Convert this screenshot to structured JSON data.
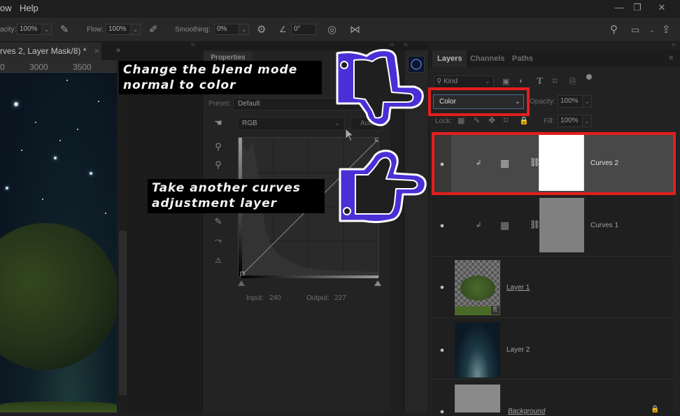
{
  "menu": {
    "items": [
      "ow",
      "Help"
    ],
    "window_controls": {
      "minimize": "—",
      "restore": "❐",
      "close": "✕"
    }
  },
  "options_bar": {
    "opacity_label": "acity:",
    "opacity_value": "100%",
    "flow_label": "Flow:",
    "flow_value": "100%",
    "smoothing_label": "Smoothing:",
    "smoothing_value": "0%",
    "angle_value": "0°",
    "icons": [
      "airbrush-icon",
      "pressure-opacity-icon",
      "settings-gear-icon",
      "angle-icon",
      "pressure-size-icon",
      "symmetry-butterfly-icon",
      "search-icon",
      "workspace-icon",
      "share-icon"
    ]
  },
  "document": {
    "tab_title": "rves 2, Layer Mask/8) *",
    "tab_close": "×",
    "ruler_ticks": [
      "0",
      "3000",
      "3500"
    ]
  },
  "properties": {
    "tab_label": "Properties",
    "preset_label": "Preset:",
    "preset_value": "Default",
    "channel_value": "RGB",
    "auto_label": "Auto",
    "input_label": "Input:",
    "input_value": "240",
    "output_label": "Output:",
    "output_value": "227",
    "tools": [
      "on-image-adjust-icon",
      "black-point-eyedropper-icon",
      "gray-point-eyedropper-icon",
      "white-point-eyedropper-icon",
      "pencil-icon",
      "smooth-curve-icon",
      "clipping-warning-icon"
    ]
  },
  "layers_panel": {
    "tabs": [
      {
        "label": "Layers",
        "active": true
      },
      {
        "label": "Channels",
        "active": false
      },
      {
        "label": "Paths",
        "active": false
      }
    ],
    "filter_label": "Kind",
    "blend_mode": "Color",
    "opacity_label": "Opacity:",
    "opacity_value": "100%",
    "lock_label": "Lock:",
    "fill_label": "Fill:",
    "fill_value": "100%",
    "layers": [
      {
        "name": "Curves 2",
        "type": "adjustment",
        "selected": true,
        "visible": true,
        "mask": "white"
      },
      {
        "name": "Curves 1",
        "type": "adjustment",
        "selected": false,
        "visible": true,
        "mask": "gray"
      },
      {
        "name": "Layer 1",
        "type": "smart-object",
        "selected": false,
        "visible": true
      },
      {
        "name": "Layer 2",
        "type": "pixel",
        "selected": false,
        "visible": true
      },
      {
        "name": "Background",
        "type": "background",
        "selected": false,
        "visible": true,
        "locked": true
      }
    ]
  },
  "annotations": {
    "top": {
      "line1": "Change the blend mode",
      "line2": "normal to color"
    },
    "bottom": {
      "line1": "Take another curves",
      "line2": "adjustment layer"
    },
    "highlight_color": "#e31e1e",
    "hand_color": "#4a2fd6"
  }
}
